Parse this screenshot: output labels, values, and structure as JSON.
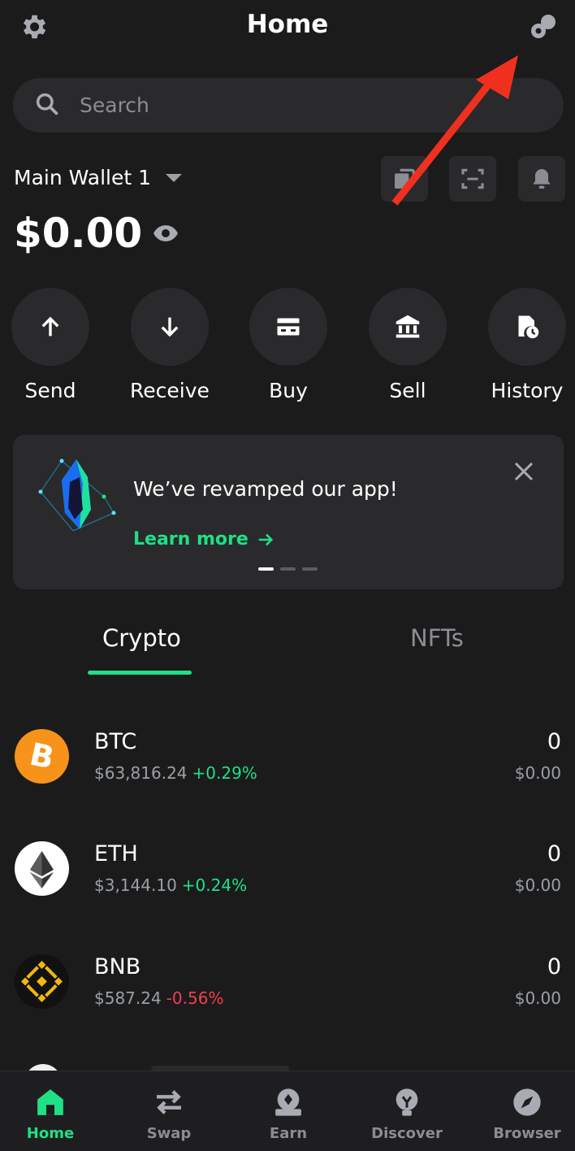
{
  "header": {
    "title": "Home",
    "settings_icon": "gear-icon",
    "connect_icon": "link-icon"
  },
  "search": {
    "placeholder": "Search"
  },
  "wallet": {
    "name": "Main Wallet 1",
    "balance": "$0.00"
  },
  "actions": [
    {
      "label": "Send",
      "icon": "arrow-up-icon"
    },
    {
      "label": "Receive",
      "icon": "arrow-down-icon"
    },
    {
      "label": "Buy",
      "icon": "card-icon"
    },
    {
      "label": "Sell",
      "icon": "bank-icon"
    },
    {
      "label": "History",
      "icon": "history-icon"
    }
  ],
  "banner": {
    "message": "We’ve revamped our app!",
    "link": "Learn more"
  },
  "tabs": {
    "crypto": "Crypto",
    "nfts": "NFTs"
  },
  "assets": [
    {
      "symbol": "BTC",
      "price": "$63,816.24",
      "change": "+0.29%",
      "amount": "0",
      "fiat": "$0.00"
    },
    {
      "symbol": "ETH",
      "price": "$3,144.10",
      "change": "+0.24%",
      "amount": "0",
      "fiat": "$0.00"
    },
    {
      "symbol": "BNB",
      "price": "$587.24",
      "change": "-0.56%",
      "amount": "0",
      "fiat": "$0.00"
    }
  ],
  "nav": [
    {
      "label": "Home"
    },
    {
      "label": "Swap"
    },
    {
      "label": "Earn"
    },
    {
      "label": "Discover"
    },
    {
      "label": "Browser"
    }
  ],
  "colors": {
    "background": "#1b1b1c",
    "accent": "#1fe085",
    "negative": "#f23f4f",
    "annotation_arrow": "#f0301e"
  }
}
